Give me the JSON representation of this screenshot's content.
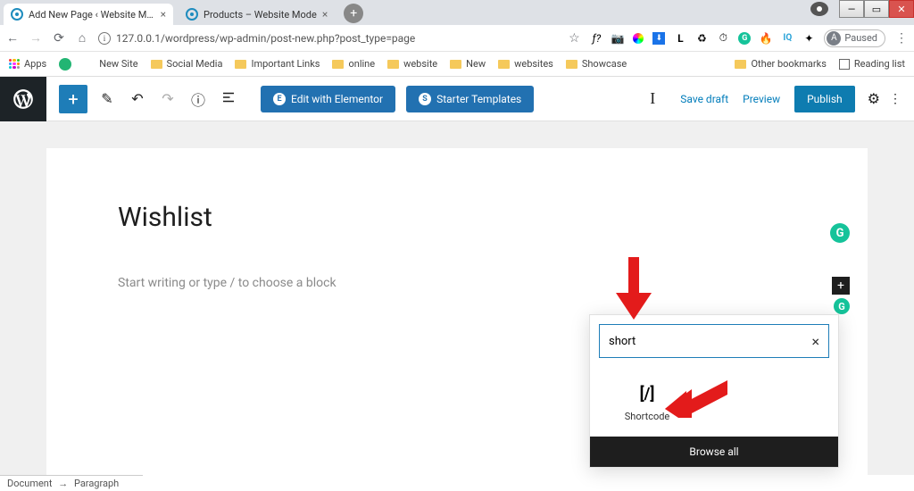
{
  "window": {
    "paused_label": "Paused",
    "avatar_letter": "A"
  },
  "tabs": [
    {
      "title": "Add New Page ‹ Website Mode"
    },
    {
      "title": "Products – Website Mode"
    }
  ],
  "url": "127.0.0.1/wordpress/wp-admin/post-new.php?post_type=page",
  "bookmarks": {
    "apps": "Apps",
    "new_site": "New Site",
    "items": [
      "Social Media",
      "Important Links",
      "online",
      "website",
      "New",
      "websites",
      "Showcase"
    ],
    "other": "Other bookmarks",
    "reading": "Reading list"
  },
  "ext_glyphs": [
    "ƒ?",
    "📷",
    "🔴",
    "⬇",
    "L",
    "♻",
    "⏱",
    "G",
    "🔥",
    "IQ",
    "✦"
  ],
  "topbar": {
    "elementor": "Edit with Elementor",
    "starter": "Starter Templates",
    "save_draft": "Save draft",
    "preview": "Preview",
    "publish": "Publish"
  },
  "editor": {
    "title": "Wishlist",
    "placeholder": "Start writing or type / to choose a block"
  },
  "inserter": {
    "search_value": "short",
    "block_label": "Shortcode",
    "block_icon": "[/]",
    "browse_all": "Browse all"
  },
  "breadcrumb": {
    "doc": "Document",
    "block": "Paragraph"
  }
}
